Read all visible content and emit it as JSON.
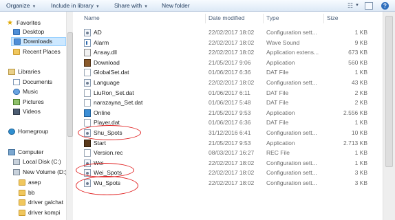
{
  "toolbar": {
    "organize": "Organize",
    "include_in_library": "Include in library",
    "share_with": "Share with",
    "new_folder": "New folder"
  },
  "nav": {
    "favorites": "Favorites",
    "desktop": "Desktop",
    "downloads": "Downloads",
    "recent_places": "Recent Places",
    "libraries": "Libraries",
    "documents": "Documents",
    "music": "Music",
    "pictures": "Pictures",
    "videos": "Videos",
    "homegroup": "Homegroup",
    "computer": "Computer",
    "local_disk": "Local Disk (C:)",
    "new_volume": "New Volume (D:)",
    "folders": [
      "asep",
      "bb",
      "driver galchat",
      "driver kompi"
    ]
  },
  "columns": {
    "name": "Name",
    "date_modified": "Date modified",
    "type": "Type",
    "size": "Size"
  },
  "files": [
    {
      "name": "AD",
      "date": "22/02/2017 18:02",
      "type": "Configuration sett...",
      "size": "1 KB",
      "icon": "config"
    },
    {
      "name": "Alarm",
      "date": "22/02/2017 18:02",
      "type": "Wave Sound",
      "size": "9 KB",
      "icon": "wave"
    },
    {
      "name": "Ansay.dll",
      "date": "22/02/2017 18:02",
      "type": "Application extens...",
      "size": "673 KB",
      "icon": "dll"
    },
    {
      "name": "Download",
      "date": "21/05/2017 9:06",
      "type": "Application",
      "size": "560 KB",
      "icon": "app"
    },
    {
      "name": "GlobalSet.dat",
      "date": "01/06/2017 6:36",
      "type": "DAT File",
      "size": "1 KB",
      "icon": "dat"
    },
    {
      "name": "Language",
      "date": "22/02/2017 18:02",
      "type": "Configuration sett...",
      "size": "43 KB",
      "icon": "config"
    },
    {
      "name": "LiuRon_Set.dat",
      "date": "01/06/2017 6:11",
      "type": "DAT File",
      "size": "2 KB",
      "icon": "dat"
    },
    {
      "name": "narazayna_Set.dat",
      "date": "01/06/2017 5:48",
      "type": "DAT File",
      "size": "2 KB",
      "icon": "dat"
    },
    {
      "name": "Online",
      "date": "21/05/2017 9:53",
      "type": "Application",
      "size": "2.556 KB",
      "icon": "app2"
    },
    {
      "name": "Player.dat",
      "date": "01/06/2017 6:36",
      "type": "DAT File",
      "size": "1 KB",
      "icon": "dat"
    },
    {
      "name": "Shu_Spots",
      "date": "31/12/2016 6:41",
      "type": "Configuration sett...",
      "size": "10 KB",
      "icon": "config"
    },
    {
      "name": "Start",
      "date": "21/05/2017 9:53",
      "type": "Application",
      "size": "2.713 KB",
      "icon": "start"
    },
    {
      "name": "Version.rec",
      "date": "08/03/2017 16:27",
      "type": "REC File",
      "size": "1 KB",
      "icon": "rec"
    },
    {
      "name": "Wei",
      "date": "22/02/2017 18:02",
      "type": "Configuration sett...",
      "size": "1 KB",
      "icon": "config"
    },
    {
      "name": "Wei_Spots",
      "date": "22/02/2017 18:02",
      "type": "Configuration sett...",
      "size": "3 KB",
      "icon": "config"
    },
    {
      "name": "Wu_Spots",
      "date": "22/02/2017 18:02",
      "type": "Configuration sett...",
      "size": "3 KB",
      "icon": "config"
    }
  ],
  "colors": {
    "annotation": "#e01e1e",
    "selection": "#cde8ff"
  }
}
